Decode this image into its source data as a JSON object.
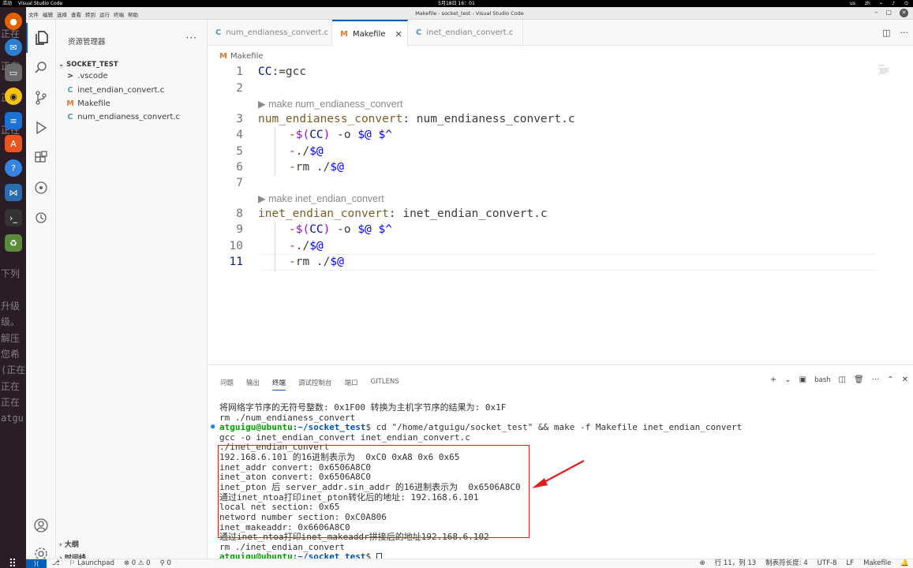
{
  "topbar": {
    "activities": "活动",
    "app": "Visual Studio Code",
    "datetime": "5月18日 16：01",
    "input": "us",
    "lang": "zh"
  },
  "window": {
    "title": "Makefile - socket_test - Visual Studio Code",
    "menus": [
      "文件",
      "编辑",
      "选择",
      "查看",
      "转到",
      "运行",
      "终端",
      "帮助"
    ]
  },
  "dock": {
    "background_text": "正在\n\n正在\n\n正在\n\n正在\n\n\n\n\n\n\n\n\n下列\n\n升级\n级。\n解压\n您希\n(正在\n正在\n正在\natgu"
  },
  "sidebar": {
    "title": "资源管理器",
    "folder": "SOCKET_TEST",
    "items": [
      {
        "label": ".vscode",
        "icon": ">",
        "color": "#3b3b3b"
      },
      {
        "label": "inet_endian_convert.c",
        "icon": "C",
        "color": "#519aba"
      },
      {
        "label": "Makefile",
        "icon": "M",
        "color": "#e37933"
      },
      {
        "label": "num_endianess_convert.c",
        "icon": "C",
        "color": "#519aba"
      }
    ],
    "outline": "大纲",
    "timeline": "时间线"
  },
  "tabs": [
    {
      "label": "num_endianess_convert.c",
      "icon": "C",
      "color": "#519aba",
      "active": false
    },
    {
      "label": "Makefile",
      "icon": "M",
      "color": "#e37933",
      "active": true
    },
    {
      "label": "inet_endian_convert.c",
      "icon": "C",
      "color": "#519aba",
      "active": false
    }
  ],
  "breadcrumb": {
    "icon": "M",
    "label": "Makefile"
  },
  "editor": {
    "lens_1": "make num_endianess_convert",
    "lens_2": "make inet_endian_convert",
    "line_numbers": [
      "1",
      "2",
      "3",
      "4",
      "5",
      "6",
      "7",
      "8",
      "9",
      "10",
      "11"
    ],
    "l1": {
      "var": "CC",
      "rest": ":=gcc"
    },
    "l3": {
      "target": "num_endianess_convert",
      "rest": ": num_endianess_convert.c"
    },
    "l8": {
      "target": "inet_endian_convert",
      "rest": ": inet_endian_convert.c"
    },
    "recipe_cc": {
      "dash": "-",
      "dol": "$(",
      "var": "CC",
      "close": ")",
      "mid": " -o ",
      "a1": "$@",
      "sp": " ",
      "a2": "$^"
    },
    "recipe_run": {
      "dash": "-",
      "pre": "./",
      "auto": "$@"
    },
    "recipe_rm": {
      "dash": "-",
      "pre": "rm ./",
      "auto": "$@"
    }
  },
  "panel": {
    "tabs": [
      "问题",
      "输出",
      "终端",
      "调试控制台",
      "端口",
      "GITLENS"
    ],
    "active_tab": "终端",
    "shell": "bash"
  },
  "terminal": {
    "lines": [
      "将网络字节序的无符号整数: 0x1F00 转换为主机字节序的结果为: 0x1F",
      "rm ./num_endianess_convert",
      "",
      "gcc -o inet_endian_convert inet_endian_convert.c",
      "./inet_endian_convert",
      "192.168.6.101 的16进制表示为  0xC0 0xA8 0x6 0x65",
      "inet_addr convert: 0x6506A8C0",
      "inet_aton convert: 0x6506A8C0",
      "inet_pton 后 server_addr.sin_addr 的16进制表示为  0x6506A8C0",
      "通过inet_ntoa打印inet_pton转化后的地址: 192.168.6.101",
      "local net section: 0x65",
      "netword number section: 0xC0A806",
      "inet_makeaddr: 0x6606A8C0",
      "通过inet_ntoa打印inet_makeaddr拼接后的地址192.168.6.102",
      "rm ./inet_endian_convert"
    ],
    "prompt_user": "atguigu@ubuntu",
    "prompt_path": ":~/socket_test",
    "prompt_cmd": "$ cd \"/home/atguigu/socket_test\" && make -f Makefile inet_endian_convert",
    "prompt_end": "$ "
  },
  "statusbar": {
    "launchpad": "Launchpad",
    "errors": "⊗ 0 ⚠ 0",
    "ports": "⚲ 0",
    "position": "行 11，列 13",
    "tabsize": "制表符长度: 4",
    "encoding": "UTF-8",
    "eol": "LF",
    "language": "Makefile"
  }
}
